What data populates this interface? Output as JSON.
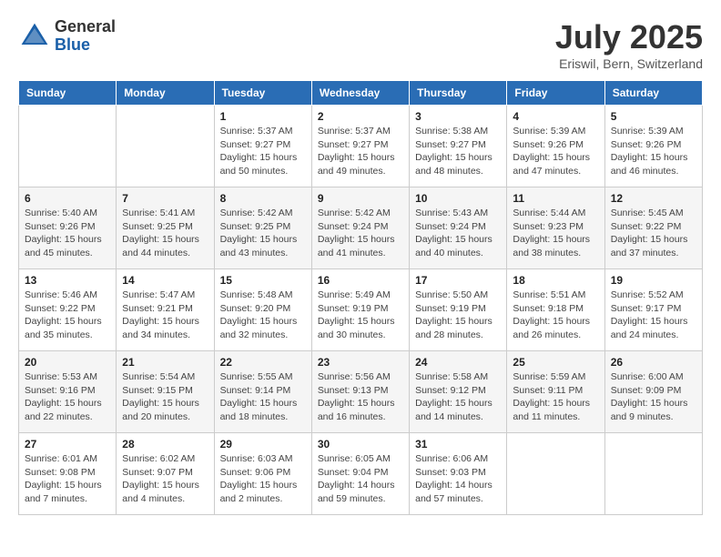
{
  "logo": {
    "general": "General",
    "blue": "Blue"
  },
  "title": {
    "month": "July 2025",
    "location": "Eriswil, Bern, Switzerland"
  },
  "headers": [
    "Sunday",
    "Monday",
    "Tuesday",
    "Wednesday",
    "Thursday",
    "Friday",
    "Saturday"
  ],
  "weeks": [
    [
      {
        "day": "",
        "detail": ""
      },
      {
        "day": "",
        "detail": ""
      },
      {
        "day": "1",
        "detail": "Sunrise: 5:37 AM\nSunset: 9:27 PM\nDaylight: 15 hours\nand 50 minutes."
      },
      {
        "day": "2",
        "detail": "Sunrise: 5:37 AM\nSunset: 9:27 PM\nDaylight: 15 hours\nand 49 minutes."
      },
      {
        "day": "3",
        "detail": "Sunrise: 5:38 AM\nSunset: 9:27 PM\nDaylight: 15 hours\nand 48 minutes."
      },
      {
        "day": "4",
        "detail": "Sunrise: 5:39 AM\nSunset: 9:26 PM\nDaylight: 15 hours\nand 47 minutes."
      },
      {
        "day": "5",
        "detail": "Sunrise: 5:39 AM\nSunset: 9:26 PM\nDaylight: 15 hours\nand 46 minutes."
      }
    ],
    [
      {
        "day": "6",
        "detail": "Sunrise: 5:40 AM\nSunset: 9:26 PM\nDaylight: 15 hours\nand 45 minutes."
      },
      {
        "day": "7",
        "detail": "Sunrise: 5:41 AM\nSunset: 9:25 PM\nDaylight: 15 hours\nand 44 minutes."
      },
      {
        "day": "8",
        "detail": "Sunrise: 5:42 AM\nSunset: 9:25 PM\nDaylight: 15 hours\nand 43 minutes."
      },
      {
        "day": "9",
        "detail": "Sunrise: 5:42 AM\nSunset: 9:24 PM\nDaylight: 15 hours\nand 41 minutes."
      },
      {
        "day": "10",
        "detail": "Sunrise: 5:43 AM\nSunset: 9:24 PM\nDaylight: 15 hours\nand 40 minutes."
      },
      {
        "day": "11",
        "detail": "Sunrise: 5:44 AM\nSunset: 9:23 PM\nDaylight: 15 hours\nand 38 minutes."
      },
      {
        "day": "12",
        "detail": "Sunrise: 5:45 AM\nSunset: 9:22 PM\nDaylight: 15 hours\nand 37 minutes."
      }
    ],
    [
      {
        "day": "13",
        "detail": "Sunrise: 5:46 AM\nSunset: 9:22 PM\nDaylight: 15 hours\nand 35 minutes."
      },
      {
        "day": "14",
        "detail": "Sunrise: 5:47 AM\nSunset: 9:21 PM\nDaylight: 15 hours\nand 34 minutes."
      },
      {
        "day": "15",
        "detail": "Sunrise: 5:48 AM\nSunset: 9:20 PM\nDaylight: 15 hours\nand 32 minutes."
      },
      {
        "day": "16",
        "detail": "Sunrise: 5:49 AM\nSunset: 9:19 PM\nDaylight: 15 hours\nand 30 minutes."
      },
      {
        "day": "17",
        "detail": "Sunrise: 5:50 AM\nSunset: 9:19 PM\nDaylight: 15 hours\nand 28 minutes."
      },
      {
        "day": "18",
        "detail": "Sunrise: 5:51 AM\nSunset: 9:18 PM\nDaylight: 15 hours\nand 26 minutes."
      },
      {
        "day": "19",
        "detail": "Sunrise: 5:52 AM\nSunset: 9:17 PM\nDaylight: 15 hours\nand 24 minutes."
      }
    ],
    [
      {
        "day": "20",
        "detail": "Sunrise: 5:53 AM\nSunset: 9:16 PM\nDaylight: 15 hours\nand 22 minutes."
      },
      {
        "day": "21",
        "detail": "Sunrise: 5:54 AM\nSunset: 9:15 PM\nDaylight: 15 hours\nand 20 minutes."
      },
      {
        "day": "22",
        "detail": "Sunrise: 5:55 AM\nSunset: 9:14 PM\nDaylight: 15 hours\nand 18 minutes."
      },
      {
        "day": "23",
        "detail": "Sunrise: 5:56 AM\nSunset: 9:13 PM\nDaylight: 15 hours\nand 16 minutes."
      },
      {
        "day": "24",
        "detail": "Sunrise: 5:58 AM\nSunset: 9:12 PM\nDaylight: 15 hours\nand 14 minutes."
      },
      {
        "day": "25",
        "detail": "Sunrise: 5:59 AM\nSunset: 9:11 PM\nDaylight: 15 hours\nand 11 minutes."
      },
      {
        "day": "26",
        "detail": "Sunrise: 6:00 AM\nSunset: 9:09 PM\nDaylight: 15 hours\nand 9 minutes."
      }
    ],
    [
      {
        "day": "27",
        "detail": "Sunrise: 6:01 AM\nSunset: 9:08 PM\nDaylight: 15 hours\nand 7 minutes."
      },
      {
        "day": "28",
        "detail": "Sunrise: 6:02 AM\nSunset: 9:07 PM\nDaylight: 15 hours\nand 4 minutes."
      },
      {
        "day": "29",
        "detail": "Sunrise: 6:03 AM\nSunset: 9:06 PM\nDaylight: 15 hours\nand 2 minutes."
      },
      {
        "day": "30",
        "detail": "Sunrise: 6:05 AM\nSunset: 9:04 PM\nDaylight: 14 hours\nand 59 minutes."
      },
      {
        "day": "31",
        "detail": "Sunrise: 6:06 AM\nSunset: 9:03 PM\nDaylight: 14 hours\nand 57 minutes."
      },
      {
        "day": "",
        "detail": ""
      },
      {
        "day": "",
        "detail": ""
      }
    ]
  ]
}
